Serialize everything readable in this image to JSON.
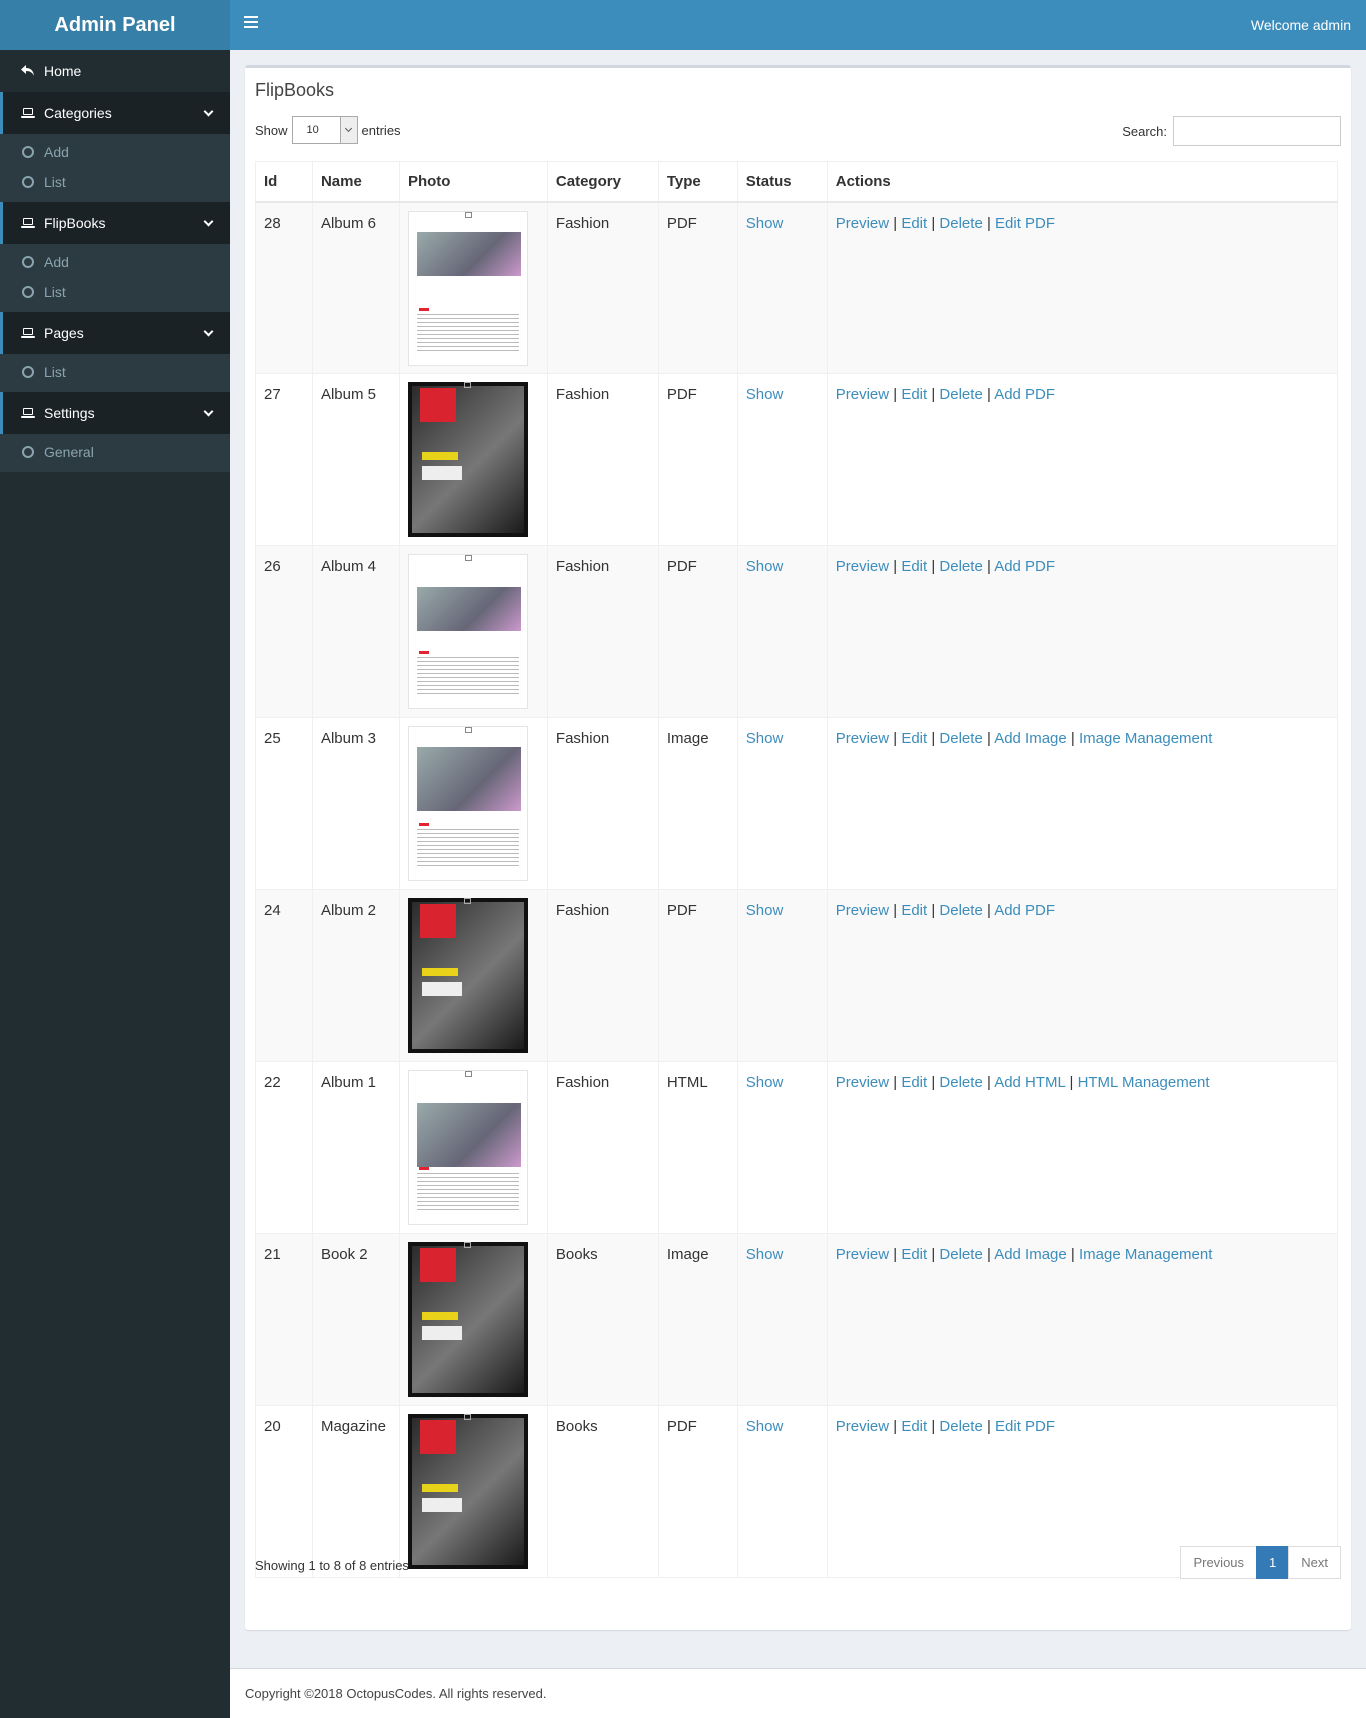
{
  "header": {
    "brand": "Admin Panel",
    "welcome": "Welcome admin"
  },
  "sidebar": {
    "home": "Home",
    "sections": [
      {
        "label": "Categories",
        "items": [
          "Add",
          "List"
        ]
      },
      {
        "label": "FlipBooks",
        "items": [
          "Add",
          "List"
        ]
      },
      {
        "label": "Pages",
        "items": [
          "List"
        ]
      },
      {
        "label": "Settings",
        "items": [
          "General"
        ]
      }
    ]
  },
  "main": {
    "title": "FlipBooks",
    "show_label": "Show",
    "entries_value": "10",
    "entries_label": "entries",
    "search_label": "Search:",
    "search_value": "",
    "columns": [
      "Id",
      "Name",
      "Photo",
      "Category",
      "Type",
      "Status",
      "Actions"
    ],
    "rows": [
      {
        "id": "28",
        "name": "Album 6",
        "category": "Fashion",
        "type": "PDF",
        "status": "Show",
        "actions": [
          "Preview",
          "Edit",
          "Delete",
          "Edit PDF"
        ],
        "thumb": "light"
      },
      {
        "id": "27",
        "name": "Album 5",
        "category": "Fashion",
        "type": "PDF",
        "status": "Show",
        "actions": [
          "Preview",
          "Edit",
          "Delete",
          "Add PDF"
        ],
        "thumb": "dark"
      },
      {
        "id": "26",
        "name": "Album 4",
        "category": "Fashion",
        "type": "PDF",
        "status": "Show",
        "actions": [
          "Preview",
          "Edit",
          "Delete",
          "Add PDF"
        ],
        "thumb": "light"
      },
      {
        "id": "25",
        "name": "Album 3",
        "category": "Fashion",
        "type": "Image",
        "status": "Show",
        "actions": [
          "Preview",
          "Edit",
          "Delete",
          "Add Image",
          "Image Management"
        ],
        "thumb": "light"
      },
      {
        "id": "24",
        "name": "Album 2",
        "category": "Fashion",
        "type": "PDF",
        "status": "Show",
        "actions": [
          "Preview",
          "Edit",
          "Delete",
          "Add PDF"
        ],
        "thumb": "dark"
      },
      {
        "id": "22",
        "name": "Album 1",
        "category": "Fashion",
        "type": "HTML",
        "status": "Show",
        "actions": [
          "Preview",
          "Edit",
          "Delete",
          "Add HTML",
          "HTML Management"
        ],
        "thumb": "light"
      },
      {
        "id": "21",
        "name": "Book 2",
        "category": "Books",
        "type": "Image",
        "status": "Show",
        "actions": [
          "Preview",
          "Edit",
          "Delete",
          "Add Image",
          "Image Management"
        ],
        "thumb": "dark"
      },
      {
        "id": "20",
        "name": "Magazine",
        "category": "Books",
        "type": "PDF",
        "status": "Show",
        "actions": [
          "Preview",
          "Edit",
          "Delete",
          "Edit PDF"
        ],
        "thumb": "dark"
      }
    ],
    "info": "Showing 1 to 8 of 8 entries",
    "pagination": {
      "previous": "Previous",
      "current": "1",
      "next": "Next"
    }
  },
  "footer": {
    "copyright": "Copyright ©2018 OctopusCodes. All rights reserved."
  }
}
